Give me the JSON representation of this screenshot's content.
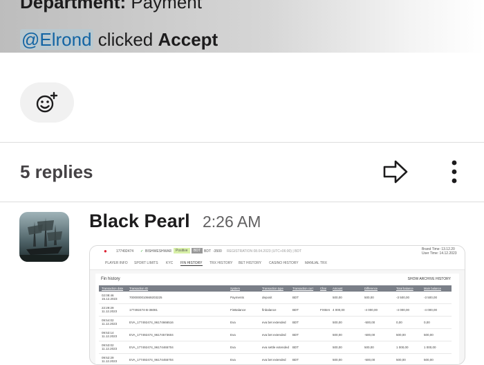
{
  "message": {
    "department_label": "Department:",
    "department_value": "Payment",
    "mention": "@Elrond",
    "action_text": "clicked",
    "action_target": "Accept"
  },
  "reaction": {
    "icon": "add-reaction-icon"
  },
  "thread": {
    "replies_label": "5 replies",
    "share_icon": "share-arrow-icon",
    "more_icon": "more-vertical-icon"
  },
  "reply": {
    "author": "Black Pearl",
    "time": "2:26 AM",
    "attachment": {
      "header": {
        "id": "177492474",
        "name": "BISHWESHWAR",
        "status": "Positive",
        "bdt": "BDT",
        "amount": "-3500",
        "registration": "REGISTRATION 08.04.2023 (UTC+06:00) | BDT",
        "brand_time": "Brand Time: 13.12.20",
        "user_time": "User Time: 14.12.2023"
      },
      "tabs": [
        "PLAYER INFO",
        "SPORT LIMITS",
        "KYC",
        "FIN HISTORY",
        "TRX HISTORY",
        "BET HISTORY",
        "CASINO HISTORY",
        "MANUAL TRX"
      ],
      "active_tab": "FIN HISTORY",
      "panel_title": "Fin history",
      "archive_link": "SHOW ARCHIVE HISTORY",
      "columns": [
        "Transaction date",
        "Transaction ID",
        "System",
        "Transaction type",
        "Transaction curr",
        "Char",
        "Amount",
        "Difference",
        "Total balance",
        "Main balance"
      ],
      "rows": [
        [
          "02:08:46\n15.12.2023",
          "7000000010669203225",
          "Payments",
          "deposit",
          "BDT",
          "",
          "500,00",
          "500,00",
          "-3 500,00",
          "-3 500,00"
        ],
        [
          "22:29:29\n11.12.2023",
          "177492474-B-36081",
          "FinBalance",
          "finbalance",
          "BDT",
          "FIXBAI",
          "4 000,00",
          "-4 000,00",
          "-4 000,00",
          "-4 000,00"
        ],
        [
          "09:54:02\n11.12.2023",
          "EVA_177492474_96174666516",
          "Eva",
          "eva bet extended",
          "BDT",
          "",
          "500,00",
          "-500,00",
          "0,00",
          "0,00"
        ],
        [
          "09:53:14\n11.12.2023",
          "EVA_177492474_96174573604",
          "Eva",
          "eva bet extended",
          "BDT",
          "",
          "500,00",
          "-500,00",
          "500,00",
          "500,00"
        ],
        [
          "09:53:02\n11.12.2023",
          "EVA_177492474_96174465704",
          "Eva",
          "eva settle extended",
          "BDT",
          "",
          "500,00",
          "500,00",
          "1 000,00",
          "1 000,00"
        ],
        [
          "09:52:29\n11.12.2023",
          "EVA_177492474_96174455704",
          "Eva",
          "eva bet extended",
          "BDT",
          "",
          "500,00",
          "-500,00",
          "500,00",
          "500,00"
        ]
      ]
    }
  }
}
